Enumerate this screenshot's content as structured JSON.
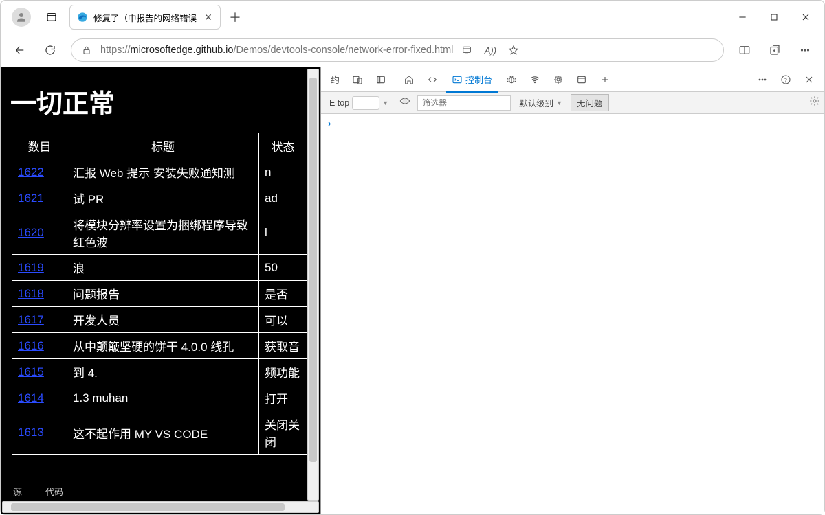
{
  "tab": {
    "title": "修复了（中报告的网络错误"
  },
  "url": {
    "prefix": "https://",
    "host": "microsoftedge.github.io",
    "path": "/Demos/devtools-console/network-error-fixed.html"
  },
  "page": {
    "heading": "一切正常",
    "columns": {
      "num": "数目",
      "title": "标题",
      "status": "状态"
    },
    "rows": [
      {
        "num": "1622",
        "title": "汇报 Web 提示     安装失败通知测",
        "status": "n"
      },
      {
        "num": "1621",
        "title": "试 PR",
        "status": "ad"
      },
      {
        "num": "1620",
        "title": "将模块分辨率设置为捆绑程序导致红色波",
        "status": "l"
      },
      {
        "num": "1619",
        "title": "浪",
        "status": "50"
      },
      {
        "num": "1618",
        "title": "问题报告",
        "status": "是否"
      },
      {
        "num": "1617",
        "title": "开发人员",
        "status": "可以"
      },
      {
        "num": "1616",
        "title": "从中颠簸坚硬的饼干 4.0.0 线孔",
        "status": "获取音"
      },
      {
        "num": "1615",
        "title": "到 4.",
        "status": "频功能"
      },
      {
        "num": "1614",
        "title": "1.3 muhan",
        "status": "打开"
      },
      {
        "num": "1613",
        "title": "这不起作用          MY VS CODE",
        "status": "关闭关闭"
      }
    ],
    "bottom": {
      "source": "源",
      "code": "代码"
    }
  },
  "devtools": {
    "console_label": "控制台",
    "yue": "约",
    "context": "E top",
    "filter_placeholder": "筛选器",
    "level_label": "默认级别",
    "issues_label": "无问题",
    "prompt": "›"
  }
}
